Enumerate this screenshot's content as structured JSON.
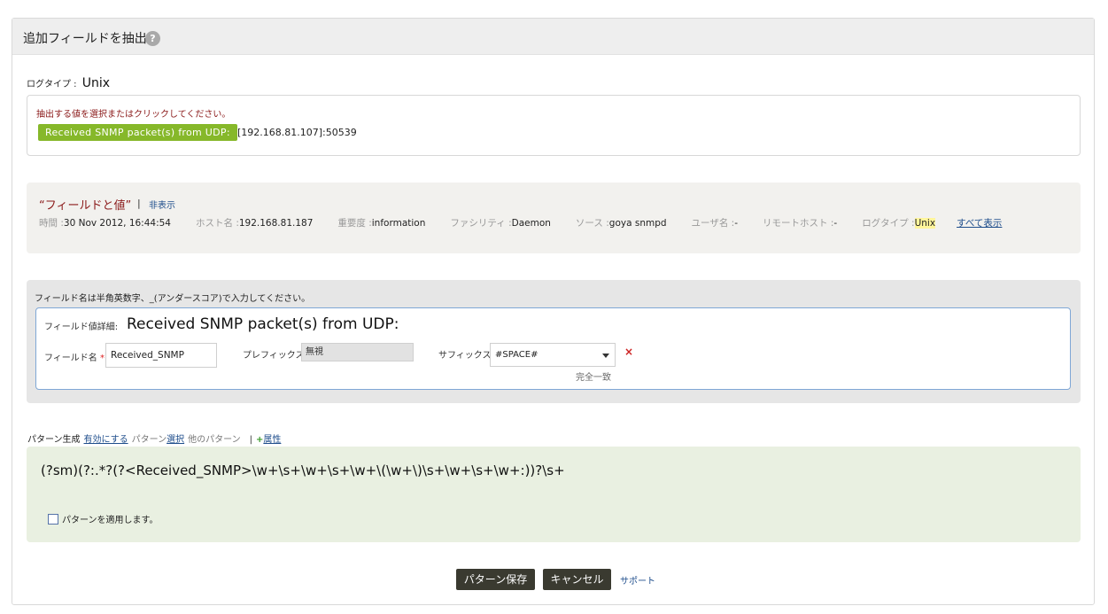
{
  "header": {
    "title": "追加フィールドを抽出",
    "help_icon": "?"
  },
  "logtype": {
    "label": "ログタイプ :",
    "value": "Unix"
  },
  "selection": {
    "instruction": "抽出する値を選択またはクリックしてください。",
    "selected_token": "Received SNMP packet(s) from UDP:",
    "remaining_text": "[192.168.81.107]:50539"
  },
  "fields_values": {
    "title": "“フィールドと値”",
    "separator": "|",
    "hide_link": "非表示",
    "items": [
      {
        "label": "時間 :",
        "value": "30 Nov 2012, 16:44:54"
      },
      {
        "label": "ホスト名 :",
        "value": "192.168.81.187"
      },
      {
        "label": "重要度 :",
        "value": "information"
      },
      {
        "label": "ファシリティ :",
        "value": "Daemon"
      },
      {
        "label": "ソース :",
        "value": "goya snmpd"
      },
      {
        "label": "ユーザ名 :",
        "value": "-"
      },
      {
        "label": "リモートホスト :",
        "value": "-"
      },
      {
        "label": "ログタイプ :",
        "value": "Unix"
      }
    ],
    "show_all": "すべて表示"
  },
  "field_name": {
    "note": "フィールド名は半角英数字、_(アンダースコア)で入力してください。",
    "detail_label": "フィールド値詳細:",
    "detail_value": "Received SNMP packet(s) from UDP:",
    "name_label": "フィールド名",
    "required_mark": "*",
    "name_value": "Received_SNMP",
    "prefix_label": "プレフィックス",
    "prefix_value": "無視",
    "suffix_label": "サフィックス",
    "suffix_value": "#SPACE#",
    "exact_match": "完全一致",
    "remove_icon": "×"
  },
  "pattern_toolbar": {
    "label": "パターン生成",
    "enable_link": "有効にする",
    "pattern_select_prefix": "パターン",
    "pattern_select_link": "選択",
    "other_patterns": "他のパターン",
    "separator": "|",
    "plus_icon": "+",
    "attribute_link": "属性"
  },
  "pattern": {
    "regex": "(?sm)(?:.*?(?<Received_SNMP>\\w+\\s+\\w+\\s+\\w+\\(\\w+\\)\\s+\\w+\\s+\\w+:))?\\s+",
    "apply_label": "パターンを適用します。"
  },
  "actions": {
    "save": "パターン保存",
    "cancel": "キャンセル",
    "support": "サポート"
  }
}
